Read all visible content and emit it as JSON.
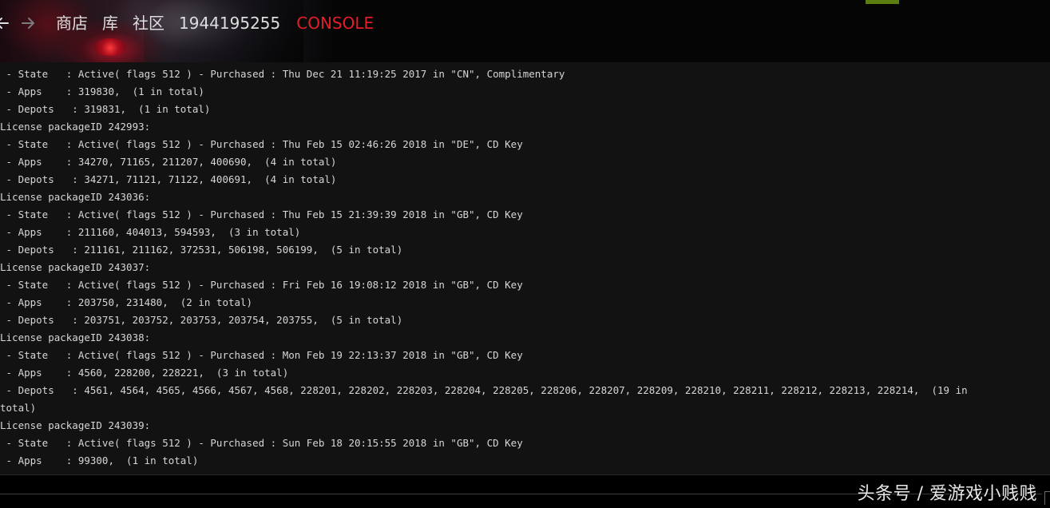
{
  "nav": {
    "back_icon": "arrow-left-icon",
    "forward_icon": "arrow-right-icon",
    "store": "商店",
    "library": "库",
    "community": "社区",
    "username": "1944195255",
    "console": "CONSOLE"
  },
  "colors": {
    "console_accent": "#e01f28",
    "nav_text": "#dcdedf",
    "log_text": "#d6d6d6",
    "console_bg": "#121212",
    "green_tab": "#5c7e10"
  },
  "log": [
    " - State   : Active( flags 512 ) - Purchased : Thu Dec 21 11:19:25 2017 in \"CN\", Complimentary",
    " - Apps    : 319830,  (1 in total)",
    " - Depots   : 319831,  (1 in total)",
    "License packageID 242993:",
    " - State   : Active( flags 512 ) - Purchased : Thu Feb 15 02:46:26 2018 in \"DE\", CD Key",
    " - Apps    : 34270, 71165, 211207, 400690,  (4 in total)",
    " - Depots   : 34271, 71121, 71122, 400691,  (4 in total)",
    "License packageID 243036:",
    " - State   : Active( flags 512 ) - Purchased : Thu Feb 15 21:39:39 2018 in \"GB\", CD Key",
    " - Apps    : 211160, 404013, 594593,  (3 in total)",
    " - Depots   : 211161, 211162, 372531, 506198, 506199,  (5 in total)",
    "License packageID 243037:",
    " - State   : Active( flags 512 ) - Purchased : Fri Feb 16 19:08:12 2018 in \"GB\", CD Key",
    " - Apps    : 203750, 231480,  (2 in total)",
    " - Depots   : 203751, 203752, 203753, 203754, 203755,  (5 in total)",
    "License packageID 243038:",
    " - State   : Active( flags 512 ) - Purchased : Mon Feb 19 22:13:37 2018 in \"GB\", CD Key",
    " - Apps    : 4560, 228200, 228221,  (3 in total)",
    " - Depots   : 4561, 4564, 4565, 4566, 4567, 4568, 228201, 228202, 228203, 228204, 228205, 228206, 228207, 228209, 228210, 228211, 228212, 228213, 228214,  (19 in",
    "total)",
    "License packageID 243039:",
    " - State   : Active( flags 512 ) - Purchased : Sun Feb 18 20:15:55 2018 in \"GB\", CD Key",
    " - Apps    : 99300,  (1 in total)"
  ],
  "command_input": {
    "value": "",
    "placeholder": ""
  },
  "watermark": "头条号 / 爱游戏小贱贱"
}
